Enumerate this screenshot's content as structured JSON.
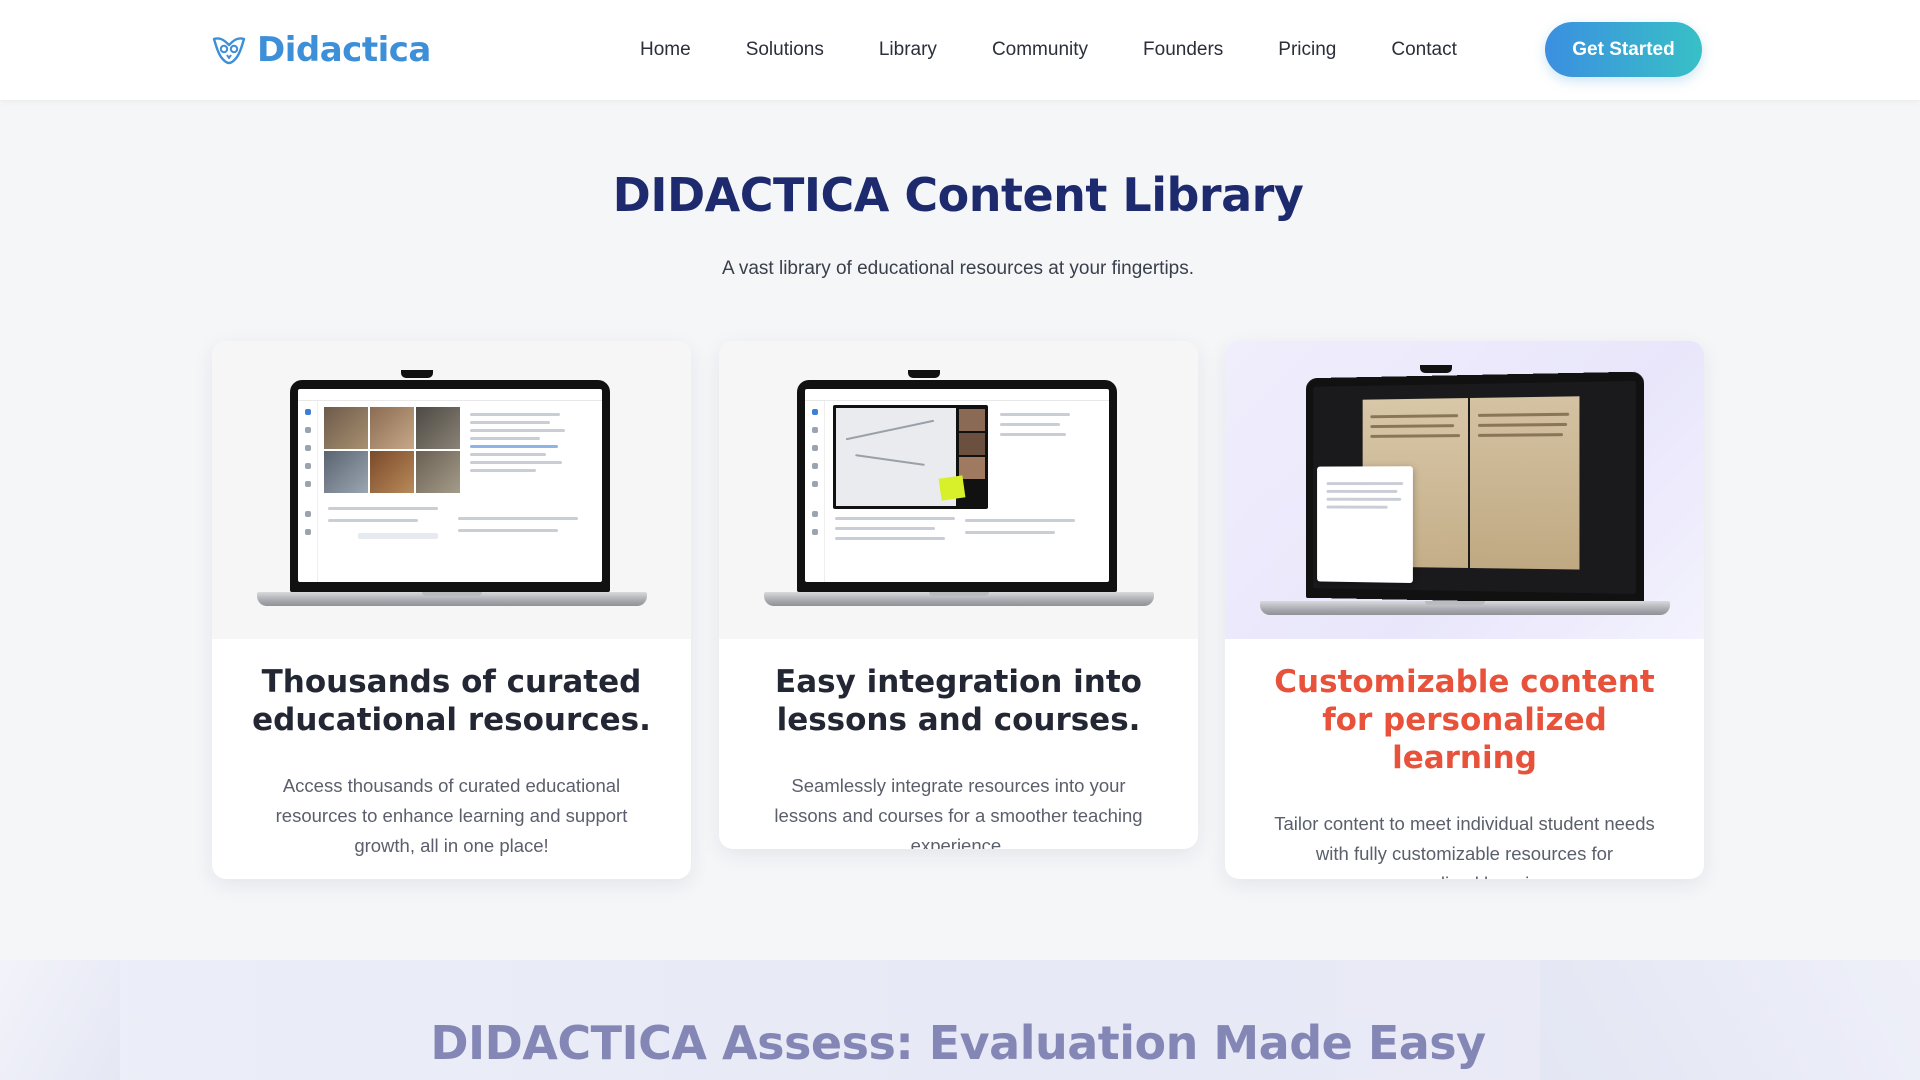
{
  "nav": {
    "brand": "Didactica",
    "links": [
      "Home",
      "Solutions",
      "Library",
      "Community",
      "Founders",
      "Pricing",
      "Contact"
    ],
    "cta": "Get Started"
  },
  "library": {
    "title": "DIDACTICA Content Library",
    "subtitle": "A vast library of educational resources at your fingertips.",
    "cards": [
      {
        "title": "Thousands of curated educational resources.",
        "body": "Access thousands of curated educational resources to enhance learning and support growth, all in one place!"
      },
      {
        "title": "Easy integration into lessons and courses.",
        "body": "Seamlessly integrate resources into your lessons and courses for a smoother teaching experience."
      },
      {
        "title": "Customizable content for personalized learning",
        "body": "Tailor content to meet individual student needs with fully customizable resources for personalized learning."
      }
    ]
  },
  "assess": {
    "title": "DIDACTICA Assess: Evaluation Made Easy"
  },
  "colors": {
    "brand": "#3d8fd8",
    "title": "#1e2a6e",
    "accent": "#e8513a",
    "cta_start": "#3b8fe0",
    "cta_end": "#38c0c6"
  },
  "icons": {
    "logo": "owl-logo-icon"
  }
}
